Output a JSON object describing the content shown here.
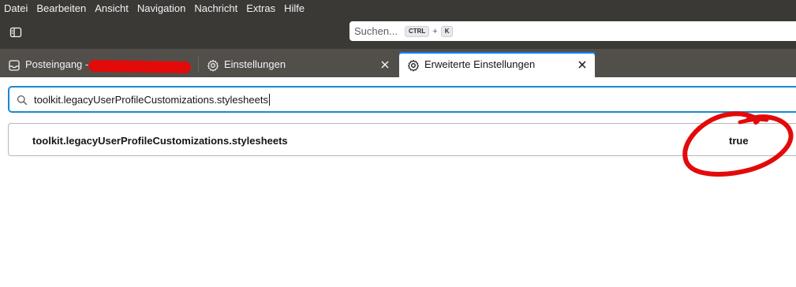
{
  "menubar": {
    "items": [
      {
        "label": "Datei"
      },
      {
        "label": "Bearbeiten"
      },
      {
        "label": "Ansicht"
      },
      {
        "label": "Navigation"
      },
      {
        "label": "Nachricht"
      },
      {
        "label": "Extras"
      },
      {
        "label": "Hilfe"
      }
    ]
  },
  "toolbar": {
    "search_placeholder": "Suchen...",
    "shortcut_key1": "CTRL",
    "shortcut_plus": "+",
    "shortcut_key2": "K"
  },
  "tabs": [
    {
      "label": "Posteingang - ",
      "icon": "inbox-icon",
      "redacted": true
    },
    {
      "label": "Einstellungen",
      "icon": "gear-icon",
      "closable": true
    },
    {
      "label": "Erweiterte Einstellungen",
      "icon": "gear-icon",
      "closable": true,
      "active": true
    }
  ],
  "pref_search": {
    "value": "toolkit.legacyUserProfileCustomizations.stylesheets"
  },
  "prefs": [
    {
      "name": "toolkit.legacyUserProfileCustomizations.stylesheets",
      "value": "true"
    }
  ],
  "colors": {
    "chrome": "#3b3936",
    "tabstrip": "#524f4b",
    "focus": "#1689d4",
    "annotation": "#e30a0a"
  }
}
